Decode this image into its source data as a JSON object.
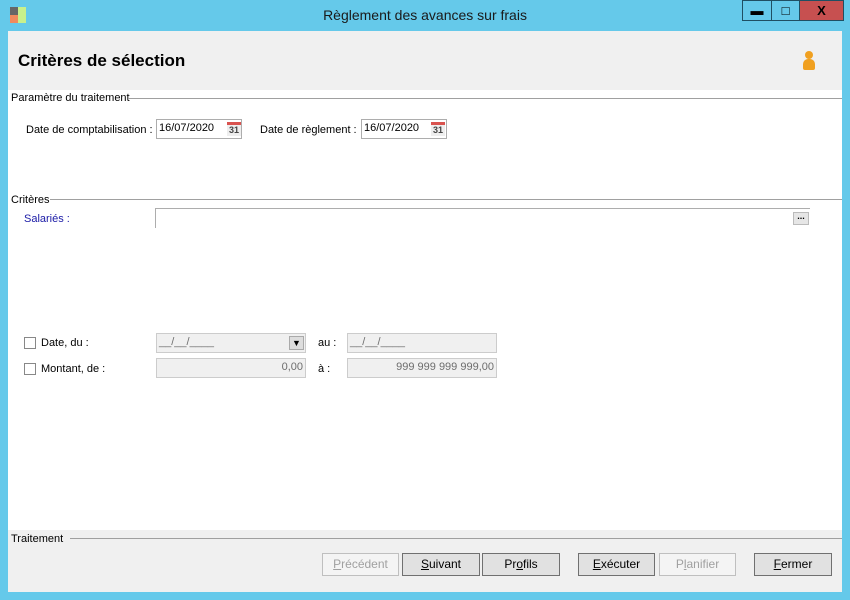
{
  "window": {
    "title": "Règlement des avances sur frais",
    "minimize": "▬",
    "maximize": "□",
    "close": "X"
  },
  "header": {
    "title": "Critères de sélection",
    "user_icon": "user-icon"
  },
  "params": {
    "group": "Paramètre du traitement",
    "compta_label": "Date de comptabilisation :",
    "compta_value": "16/07/2020",
    "reglement_label": "Date de règlement :",
    "reglement_value": "16/07/2020",
    "cal_text": "31"
  },
  "criteres": {
    "group": "Critères",
    "salaries_label": "Salariés :",
    "salaries_value": "",
    "ellipsis": "...",
    "date_label": "Date, du :",
    "date_from": "__/__/____",
    "date_to_label": "au :",
    "date_to": "__/__/____",
    "date_checked": false,
    "montant_label": "Montant, de :",
    "montant_from": "0,00",
    "montant_to_label": "à :",
    "montant_to": "999 999 999 999,00",
    "montant_checked": false
  },
  "traitement": {
    "group": "Traitement"
  },
  "buttons": [
    {
      "pre": "",
      "key": "P",
      "post": "récédent",
      "enabled": false
    },
    {
      "pre": "",
      "key": "S",
      "post": "uivant",
      "enabled": true
    },
    {
      "pre": "Pr",
      "key": "o",
      "post": "fils",
      "enabled": true
    },
    {
      "pre": "",
      "key": "E",
      "post": "xécuter",
      "enabled": true
    },
    {
      "pre": "P",
      "key": "l",
      "post": "anifier",
      "enabled": false
    },
    {
      "pre": "",
      "key": "F",
      "post": "ermer",
      "enabled": true
    }
  ]
}
